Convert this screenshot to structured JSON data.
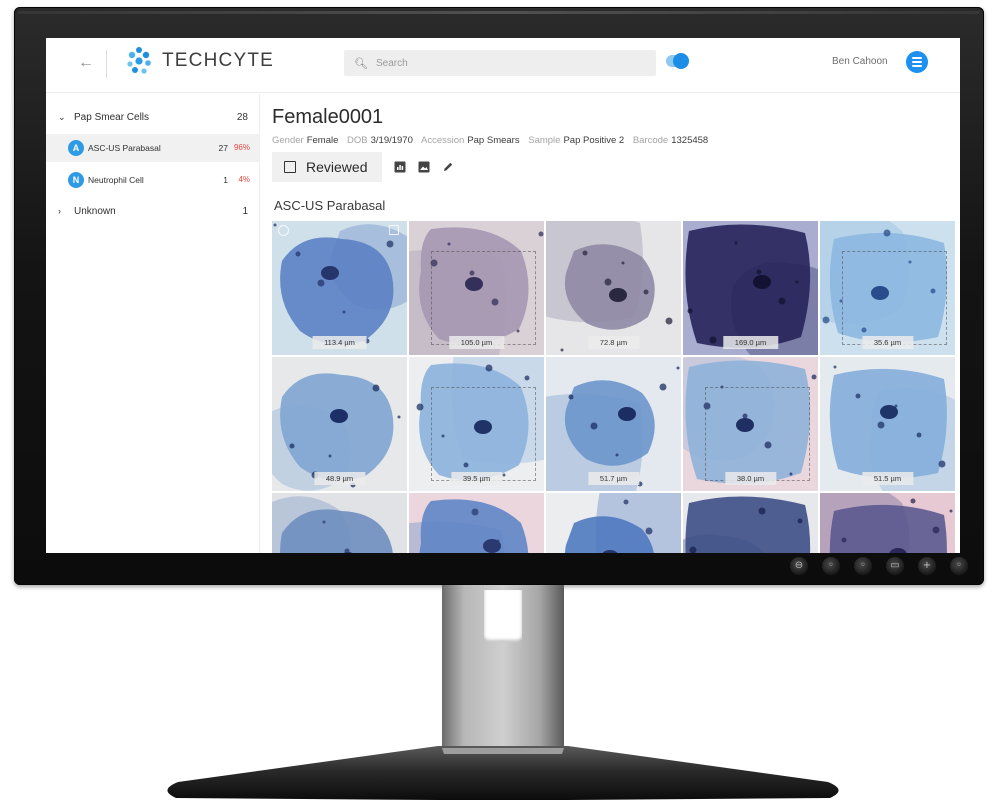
{
  "header": {
    "back_icon": "arrow-left-icon",
    "brand": "TECHCYTE",
    "search_placeholder": "Search",
    "toggle_on": true,
    "user_name": "Ben Cahoon",
    "accent": "#1e90f0"
  },
  "sidebar": {
    "groups": [
      {
        "label": "Pap Smear Cells",
        "count": "28",
        "expanded": true
      },
      {
        "label": "Unknown",
        "count": "1",
        "expanded": false
      }
    ],
    "items": [
      {
        "badge": "A",
        "label": "ASC-US Parabasal",
        "count": "27",
        "pct": "96%",
        "selected": true
      },
      {
        "badge": "N",
        "label": "Neutrophil Cell",
        "count": "1",
        "pct": "4%",
        "selected": false
      }
    ]
  },
  "patient": {
    "title": "Female0001",
    "meta": [
      {
        "k": "Gender",
        "v": "Female"
      },
      {
        "k": "DOB",
        "v": "3/19/1970"
      },
      {
        "k": "Accession",
        "v": "Pap Smears"
      },
      {
        "k": "Sample",
        "v": "Pap Positive 2"
      },
      {
        "k": "Barcode",
        "v": "1325458"
      }
    ]
  },
  "toolbar": {
    "reviewed_label": "Reviewed",
    "icons": [
      "chart-icon",
      "image-icon",
      "pencil-icon"
    ]
  },
  "section_title": "ASC-US Parabasal",
  "cells": [
    {
      "size": "113.4 µm",
      "bg": "#cfe0ea",
      "cell": "#5b82c4",
      "nucleus": "#26356c"
    },
    {
      "size": "105.0 µm",
      "bg": "#d9d1d6",
      "cell": "#a597b2",
      "nucleus": "#34305a"
    },
    {
      "size": "72.8 µm",
      "bg": "#e6e6e8",
      "cell": "#8f8aa6",
      "nucleus": "#2a2840"
    },
    {
      "size": "169.0 µm",
      "bg": "#a9aed0",
      "cell": "#26245a",
      "nucleus": "#131232"
    },
    {
      "size": "35.6 µm",
      "bg": "#cde0ee",
      "cell": "#8db8e0",
      "nucleus": "#284c8c"
    },
    {
      "size": "48.9 µm",
      "bg": "#e7e8ea",
      "cell": "#7fa5d2",
      "nucleus": "#1c2f66"
    },
    {
      "size": "39.5 µm",
      "bg": "#eceef0",
      "cell": "#8cb3dc",
      "nucleus": "#1f3366"
    },
    {
      "size": "51.7 µm",
      "bg": "#e3e9ef",
      "cell": "#6c96cb",
      "nucleus": "#1b2d63"
    },
    {
      "size": "38.0 µm",
      "bg": "#ead7de",
      "cell": "#8fb1d9",
      "nucleus": "#1f2f63"
    },
    {
      "size": "51.5 µm",
      "bg": "#e5eaef",
      "cell": "#84aedb",
      "nucleus": "#1f3469"
    },
    {
      "size": "",
      "bg": "#e0e2e6",
      "cell": "#6f8fc0",
      "nucleus": "#2b3b72"
    },
    {
      "size": "",
      "bg": "#ead6dc",
      "cell": "#5f86c6",
      "nucleus": "#2a3a70"
    },
    {
      "size": "",
      "bg": "#ecedef",
      "cell": "#4f79bf",
      "nucleus": "#24356c"
    },
    {
      "size": "",
      "bg": "#e7e8eb",
      "cell": "#3d4f86",
      "nucleus": "#1a2250"
    },
    {
      "size": "",
      "bg": "#e6c9d2",
      "cell": "#5b5a90",
      "nucleus": "#2a2858"
    }
  ],
  "monitor_buttons": [
    "⊖",
    "◦",
    "◦",
    "▭",
    "+",
    "◦"
  ]
}
